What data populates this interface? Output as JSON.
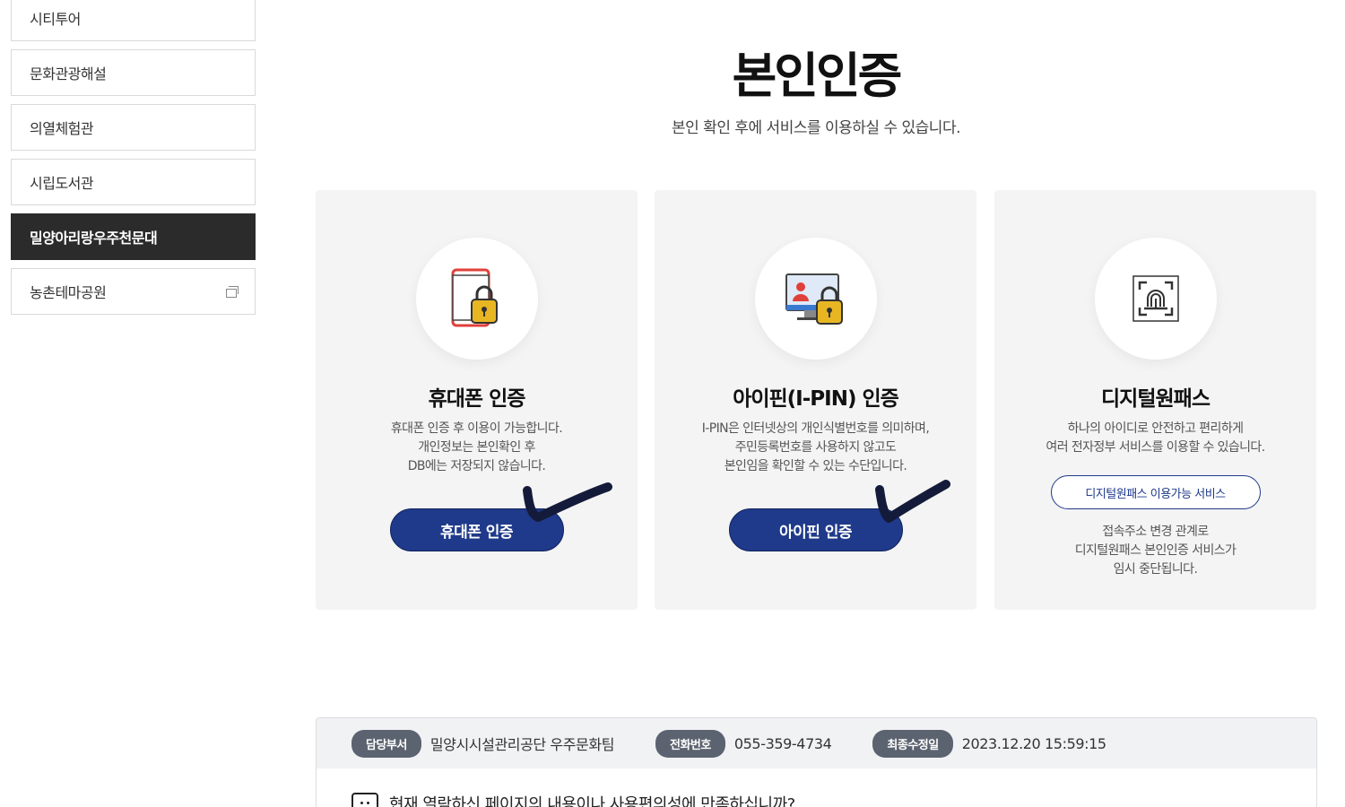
{
  "sidebar": {
    "items": [
      {
        "label": "시티투어",
        "active": false,
        "external": false
      },
      {
        "label": "문화관광해설",
        "active": false,
        "external": false
      },
      {
        "label": "의열체험관",
        "active": false,
        "external": false
      },
      {
        "label": "시립도서관",
        "active": false,
        "external": false
      },
      {
        "label": "밀양아리랑우주천문대",
        "active": true,
        "external": false
      },
      {
        "label": "농촌테마공원",
        "active": false,
        "external": true
      }
    ]
  },
  "header": {
    "title": "본인인증",
    "subtitle": "본인 확인 후에 서비스를 이용하실 수 있습니다."
  },
  "cards": {
    "phone": {
      "title": "휴대폰 인증",
      "desc": [
        "휴대폰 인증 후 이용이 가능합니다.",
        "개인정보는 본인확인 후",
        "DB에는 저장되지 않습니다."
      ],
      "button": "휴대폰 인증",
      "icon": "phone-lock-icon"
    },
    "ipin": {
      "title": "아이핀(I-PIN) 인증",
      "desc": [
        "I-PIN은 인터넷상의 개인식별번호를 의미하며,",
        "주민등록번호를 사용하지 않고도",
        "본인임을 확인할 수 있는 수단입니다."
      ],
      "button": "아이핀 인증",
      "icon": "monitor-lock-icon"
    },
    "digital": {
      "title": "디지털원패스",
      "desc": [
        "하나의 아이디로 안전하고 편리하게",
        "여러 전자정부 서비스를 이용할 수 있습니다."
      ],
      "button": "디지털원패스 이용가능 서비스",
      "note": [
        "접속주소 변경 관계로",
        "디지털원패스 본인인증 서비스가",
        "임시 중단됩니다."
      ],
      "icon": "fingerprint-icon"
    }
  },
  "info": {
    "dept_label": "담당부서",
    "dept_value": "밀양시시설관리공단 우주문화팀",
    "phone_label": "전화번호",
    "phone_value": "055-359-4734",
    "updated_label": "최종수정일",
    "updated_value": "2023.12.20 15:59:15"
  },
  "feedback": {
    "text": "현재 열람하신 페이지의 내용이나 사용편의성에 만족하십니까?"
  },
  "colors": {
    "primary": "#1f3a8a",
    "sidebar_active": "#2b2b2b",
    "card_bg": "#f4f4f4",
    "pill": "#5c6370",
    "accent_red": "#e0403a",
    "accent_gold": "#e8b623"
  }
}
